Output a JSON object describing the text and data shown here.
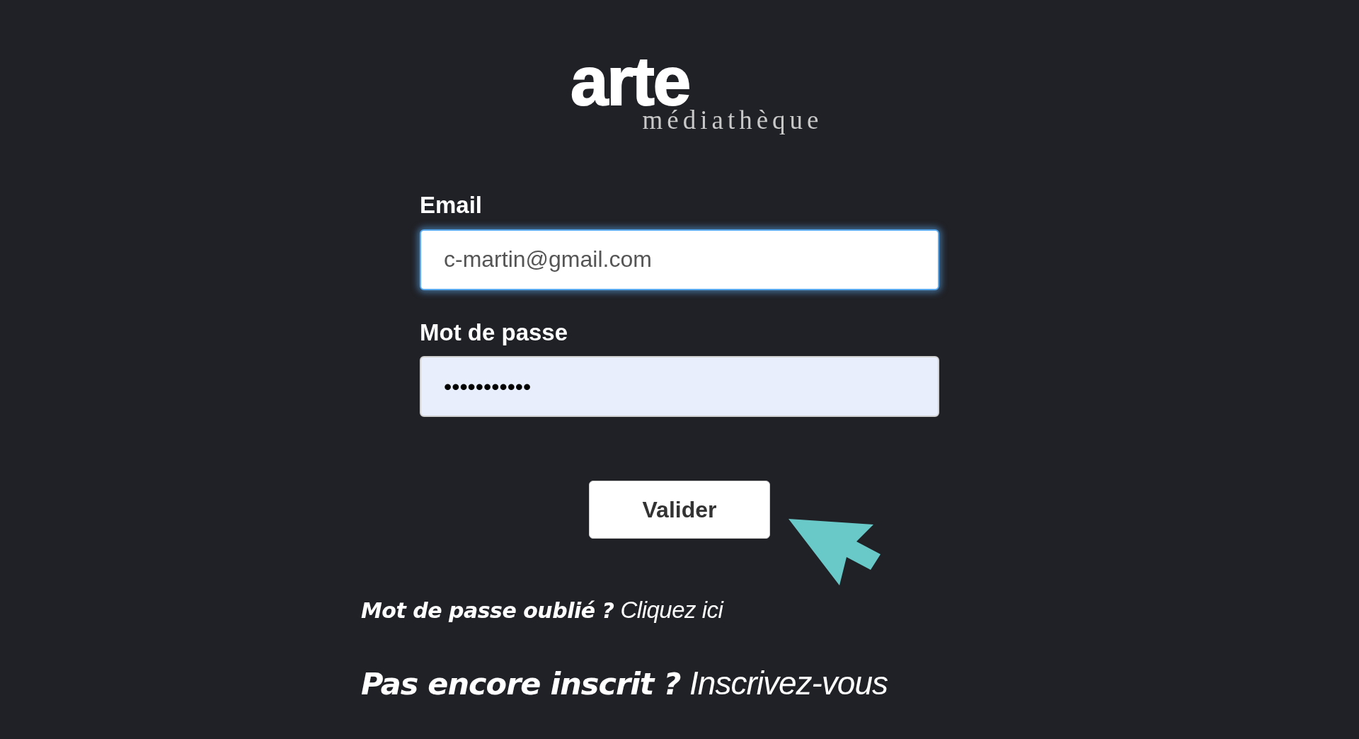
{
  "logo": {
    "brand": "arte",
    "subtitle": "médiathèque"
  },
  "fields": [
    {
      "label": "Email",
      "value": "c-martin@gmail.com",
      "focused": true,
      "autofilled": false
    },
    {
      "label": "Mot de passe",
      "value": "•••••••••••",
      "focused": false,
      "autofilled": true
    }
  ],
  "submit_button": "Valider",
  "links": [
    {
      "prompt": "Mot de passe oublié ?",
      "link": "Cliquez ici",
      "kind": "hint"
    },
    {
      "prompt": "Pas encore inscrit ?",
      "link": "Inscrivez-vous",
      "kind": "signup"
    }
  ]
}
